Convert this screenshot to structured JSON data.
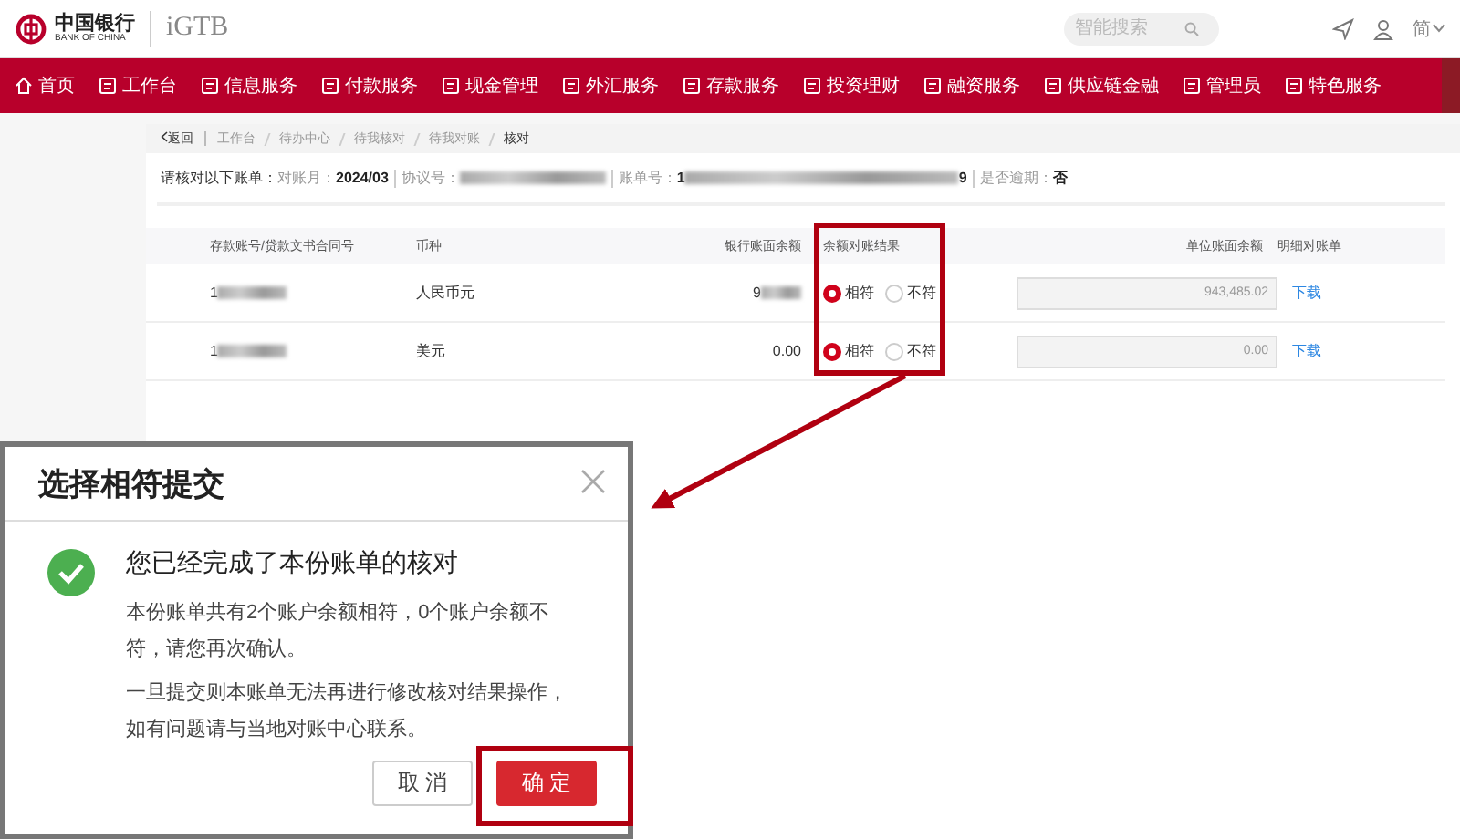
{
  "header": {
    "logo_name": "中国银行",
    "logo_english": "BANK OF CHINA",
    "product": "iGTB",
    "search": {
      "placeholder": "智能搜索"
    },
    "language": "简"
  },
  "nav": [
    {
      "label": "首页"
    },
    {
      "label": "工作台"
    },
    {
      "label": "信息服务"
    },
    {
      "label": "付款服务"
    },
    {
      "label": "现金管理"
    },
    {
      "label": "外汇服务"
    },
    {
      "label": "存款服务"
    },
    {
      "label": "投资理财"
    },
    {
      "label": "融资服务"
    },
    {
      "label": "供应链金融"
    },
    {
      "label": "管理员"
    },
    {
      "label": "特色服务"
    }
  ],
  "breadcrumb": {
    "back": "返回",
    "items": [
      {
        "label": "工作台",
        "current": false
      },
      {
        "label": "待办中心",
        "current": false
      },
      {
        "label": "待我核对",
        "current": false
      },
      {
        "label": "待我对账",
        "current": false
      },
      {
        "label": "核对",
        "current": true
      }
    ]
  },
  "info": {
    "label": "请核对以下账单：",
    "fields": [
      {
        "name": "对账月：",
        "value": "2024/03",
        "redacted": false
      },
      {
        "name": "协议号：",
        "redacted": true
      },
      {
        "name": "账单号：",
        "value": "1",
        "redacted": true,
        "suffix": "9"
      },
      {
        "name": "是否逾期：",
        "value": "否",
        "redacted": false
      }
    ]
  },
  "table": {
    "columns": [
      "存款账号/贷款文书合同号",
      "币种",
      "银行账面余额",
      "余额对账结果",
      "单位账面余额",
      "明细对账单"
    ],
    "rows": [
      {
        "account": "1",
        "account_redacted": true,
        "currency": "人民币元",
        "bank_balance": "9",
        "bank_balance_redacted": true,
        "options": [
          {
            "label": "相符",
            "selected": true
          },
          {
            "label": "不符",
            "selected": false
          }
        ],
        "unit_balance": "943,485.02",
        "download": "下载"
      },
      {
        "account": "1",
        "account_redacted": true,
        "currency": "美元",
        "bank_balance": "0.00",
        "bank_balance_redacted": false,
        "options": [
          {
            "label": "相符",
            "selected": true
          },
          {
            "label": "不符",
            "selected": false
          }
        ],
        "unit_balance": "0.00",
        "download": "下载"
      }
    ]
  },
  "dialog": {
    "title": "选择相符提交",
    "heading": "您已经完成了本份账单的核对",
    "paragraphs": [
      "本份账单共有2个账户余额相符，0个账户余额不符，请您再次确认。",
      "一旦提交则本账单无法再进行修改核对结果操作，如有问题请与当地对账中心联系。"
    ],
    "cancel": "取 消",
    "confirm": "确 定"
  }
}
